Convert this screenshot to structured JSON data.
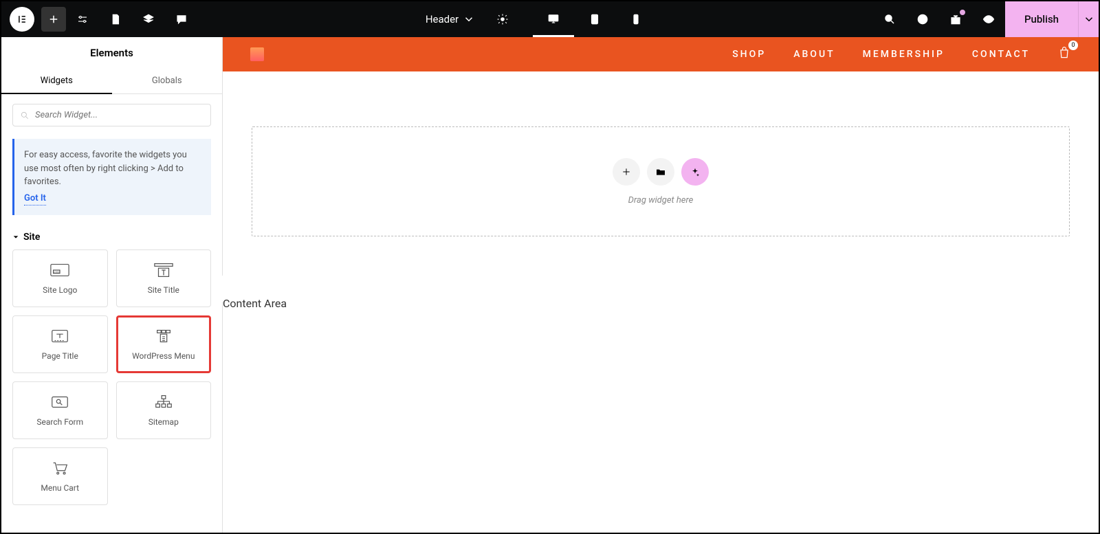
{
  "topbar": {
    "header_label": "Header",
    "publish_label": "Publish"
  },
  "sidebar": {
    "title": "Elements",
    "tabs": {
      "widgets": "Widgets",
      "globals": "Globals"
    },
    "search_placeholder": "Search Widget...",
    "tip": {
      "text": "For easy access, favorite the widgets you use most often by right clicking > Add to favorites.",
      "gotit": "Got It"
    },
    "category": "Site",
    "widgets": [
      {
        "label": "Site Logo"
      },
      {
        "label": "Site Title"
      },
      {
        "label": "Page Title"
      },
      {
        "label": "WordPress Menu"
      },
      {
        "label": "Search Form"
      },
      {
        "label": "Sitemap"
      },
      {
        "label": "Menu Cart"
      }
    ]
  },
  "canvas": {
    "nav": {
      "shop": "SHOP",
      "about": "ABOUT",
      "membership": "MEMBERSHIP",
      "contact": "CONTACT"
    },
    "cart_count": "0",
    "drop_text": "Drag widget here",
    "content_area": "Content Area"
  }
}
